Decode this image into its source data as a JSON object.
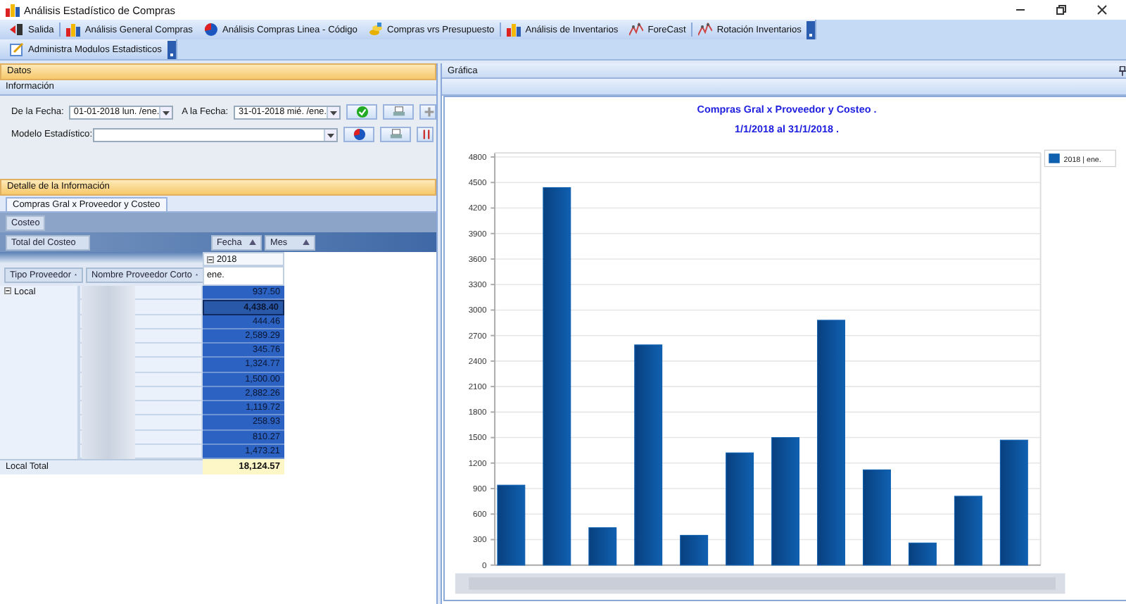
{
  "window": {
    "title": "Análisis Estadístico de Compras"
  },
  "toolbar": [
    {
      "label": "Salida"
    },
    {
      "label": "Análisis General Compras"
    },
    {
      "label": "Análisis Compras Linea - Código"
    },
    {
      "label": "Compras vrs Presupuesto"
    },
    {
      "label": "Análisis de Inventarios"
    },
    {
      "label": "ForeCast"
    },
    {
      "label": "Rotación Inventarios"
    }
  ],
  "toolbar2": [
    {
      "label": "Administra Modulos Estadisticos"
    }
  ],
  "datos": {
    "title": "Datos",
    "subtitle": "Información",
    "from_label": "De la Fecha:",
    "from_value": "01-01-2018  lun. /ene.",
    "to_label": "A la Fecha:",
    "to_value": "31-01-2018  mié. /ene.",
    "model_label": "Modelo Estadístico:"
  },
  "detalle": {
    "title": "Detalle de la Información",
    "tabs": [
      {
        "label": "Compras Gral x Proveedor y Costeo",
        "selected": true
      }
    ],
    "filter_field": "Costeo",
    "data_field": "Total del Costeo",
    "column_fields": [
      "Fecha",
      "Mes"
    ],
    "year": "2018",
    "month": "ene.",
    "row_fields": [
      "Tipo Proveedor",
      "Nombre Proveedor Corto"
    ],
    "group": "Local",
    "group_total_label": "Local Total",
    "values": [
      {
        "value": "937.50",
        "selected": false
      },
      {
        "value": "4,438.40",
        "selected": true
      },
      {
        "value": "444.46",
        "selected": false
      },
      {
        "value": "2,589.29",
        "selected": false
      },
      {
        "value": "345.76",
        "selected": false
      },
      {
        "value": "1,324.77",
        "selected": false
      },
      {
        "value": "1,500.00",
        "selected": false
      },
      {
        "value": "2,882.26",
        "selected": false
      },
      {
        "value": "1,119.72",
        "selected": false
      },
      {
        "value": "258.93",
        "selected": false
      },
      {
        "value": "810.27",
        "selected": false
      },
      {
        "value": "1,473.21",
        "selected": false
      }
    ],
    "group_total": "18,124.57"
  },
  "grafica": {
    "title": "Gráfica",
    "subtitle": "1/1/2018 al 31/1/2018  .",
    "chart_data": {
      "type": "bar",
      "title": "Compras Gral x Proveedor y Costeo  .",
      "series": [
        {
          "name": "2018 | ene.",
          "color": "#1060b0",
          "values": [
            940,
            4440,
            440,
            2590,
            350,
            1320,
            1500,
            2880,
            1120,
            260,
            810,
            1470
          ]
        }
      ],
      "grid": true,
      "ylim": [
        0,
        4800
      ],
      "yticks": [
        0,
        300,
        600,
        900,
        1200,
        1500,
        1800,
        2100,
        2400,
        2700,
        3000,
        3300,
        3600,
        3900,
        4200,
        4500,
        4800
      ]
    }
  }
}
